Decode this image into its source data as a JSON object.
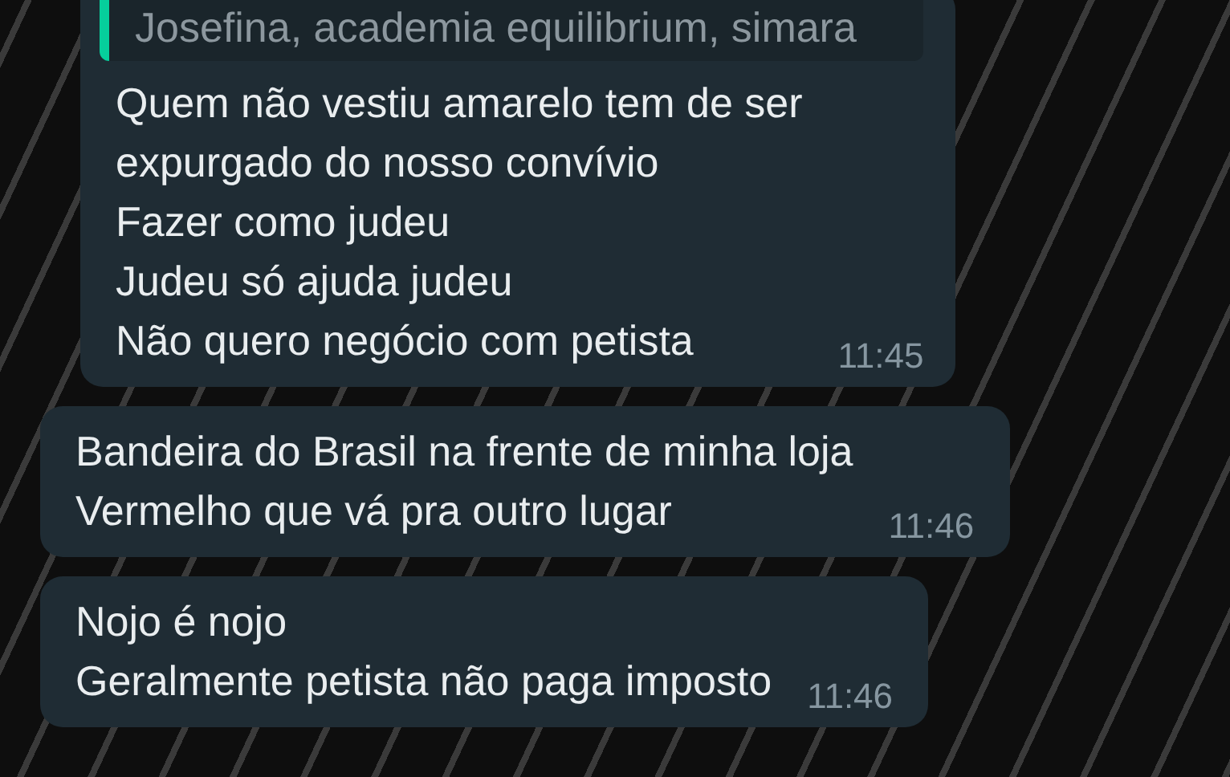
{
  "messages": [
    {
      "quote": {
        "author": "Josefina, academia equilibrium, simara",
        "color": "#06cf9c"
      },
      "text": "Quem não vestiu amarelo tem de ser\nexpurgado do nosso convívio\nFazer como judeu\nJudeu só ajuda judeu\nNão quero negócio com petista",
      "time": "11:45"
    },
    {
      "text": "Bandeira do Brasil na frente de minha loja\nVermelho que vá pra outro lugar",
      "time": "11:46"
    },
    {
      "text": "Nojo é nojo\nGeralmente petista não paga imposto",
      "time": "11:46"
    }
  ]
}
